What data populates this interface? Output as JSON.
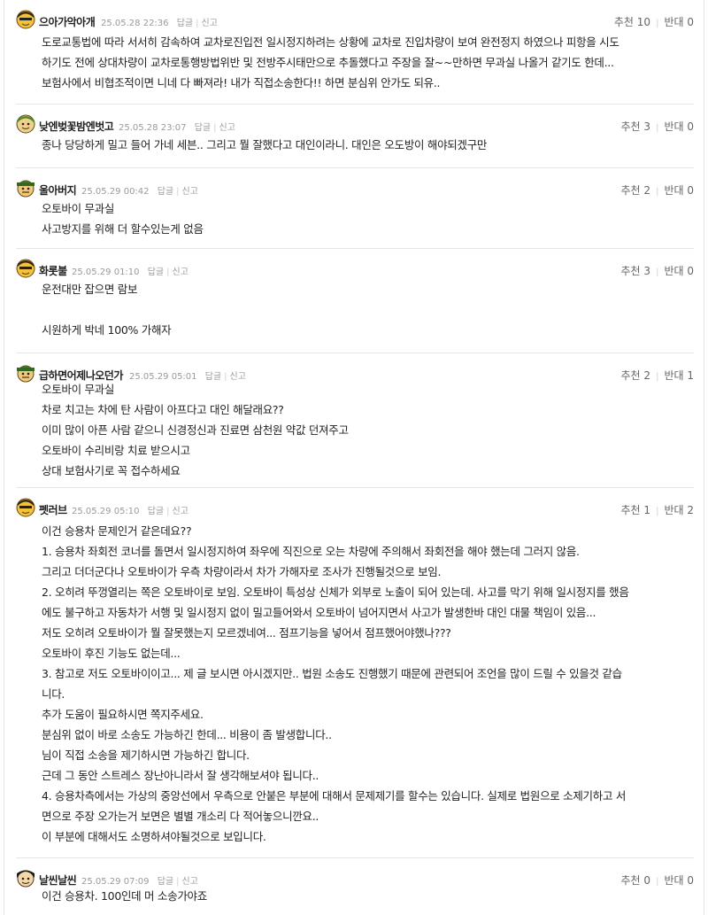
{
  "vote_labels": {
    "up": "추천",
    "down": "반대"
  },
  "actions": {
    "reply": "답글",
    "report": "신고"
  },
  "comments": [
    {
      "nickname": "으아가악아개",
      "date": "25.05.28 22:36",
      "up": "10",
      "down": "0",
      "avatar_icon": "yellow-avatar-icon",
      "lines": [
        "도로교통법에 따라 서서히 감속하여 교차로진입전 일시정지하려는 상황에 교차로 진입차량이 보여 완전정지 하였으나 피항을 시도",
        "하기도 전에 상대차량이 교차로통행방법위반 및 전방주시태만으로 추돌했다고 주장을 잘~~만하면 무과실 나올거 같기도 한데...",
        "보험사에서 비협조적이면 니네 다 빠져라! 내가 직접소송한다!! 하면 분심위 안가도 되유.."
      ]
    },
    {
      "nickname": "낮엔벚꽃밤엔벗고",
      "date": "25.05.28 23:07",
      "up": "3",
      "down": "0",
      "avatar_icon": "green-avatar-icon",
      "lines": [
        "종나 당당하게 밀고 들어 가네 세븐.. 그리고 뭘 잘했다고 대인이라니. 대인은 오도방이 해야되겠구만"
      ]
    },
    {
      "nickname": "울아버지",
      "date": "25.05.29 00:42",
      "up": "2",
      "down": "0",
      "avatar_icon": "soldier-avatar-icon",
      "lines": [
        "오토바이 무과실",
        "사고방지를 위해 더 할수있는게 없음"
      ]
    },
    {
      "nickname": "화롯불",
      "date": "25.05.29 01:10",
      "up": "3",
      "down": "0",
      "avatar_icon": "yellow-avatar-icon",
      "lines": [
        "운전대만 잡으면 람보",
        "",
        "시원하게 박네 100% 가해자"
      ]
    },
    {
      "nickname": "급하면어제나오던가",
      "date": "25.05.29 05:01",
      "up": "2",
      "down": "1",
      "avatar_icon": "soldier-avatar-icon",
      "lines": [
        "오토바이 무과실",
        "차로 치고는 차에 탄 사람이 아프다고 대인 해달래요??",
        "이미 많이 아픈 사람 같으니 신경정신과 진료면 삼천원 약값 던져주고",
        "오토바이 수리비랑 치료 받으시고",
        "상대 보험사기로 꼭 접수하세요"
      ]
    },
    {
      "nickname": "펫러브",
      "date": "25.05.29 05:10",
      "up": "1",
      "down": "2",
      "avatar_icon": "yellow-avatar-icon",
      "lines": [
        "이건 승용차 문제인거 같은데요??",
        "1. 승용차 좌회전 코너를 돌면서 일시정지하여 좌우에 직진으로 오는 차량에 주의해서 좌회전을 해야 했는데 그러지 않음.",
        "그리고 더더군다나 오토바이가 우측 차량이라서 차가 가해자로 조사가 진행될것으로 보임.",
        "2. 오히려 뚜껑열리는 쪽은 오토바이로 보임. 오토바이 특성상 신체가 외부로 노출이 되어 있는데. 사고를 막기 위해 일시정지를 했음",
        "에도 불구하고 자동차가 서행 및 일시정지 없이 밀고들어와서 오토바이 넘어지면서 사고가 발생한바 대인 대물 책임이 있음...",
        "저도 오히려 오토바이가 뭘 잘못했는지 모르겠네여... 점프기능을 넣어서 점프했어야했나???",
        "오토바이 후진 기능도 없는데...",
        "3. 참고로 저도 오토바이이고... 제 글 보시면 아시겠지만.. 법원 소송도 진행했기 때문에 관련되어 조언을 많이 드릴 수 있을것 같습",
        "니다.",
        "추가 도움이 필요하시면 쪽지주세요.",
        "분심위 없이 바로 소송도 가능하긴 한데... 비용이 좀 발생합니다..",
        "님이 직접 소송을 제기하시면 가능하긴 합니다.",
        "근데 그 동안 스트레스 장난아니라서 잘 생각해보셔야 됩니다..",
        "4. 승용차측에서는 가상의 중앙선에서 우측으로 안붙은 부분에 대해서 문제제기를 할수는 있습니다. 실제로 법원으로 소제기하고 서",
        "면으로 주장 오가는거 보면은 별별 개소리 다 적어놓으니깐요..",
        "이 부분에 대해서도 소명하셔야될것으로 보입니다."
      ]
    },
    {
      "nickname": "날씬날씬",
      "date": "25.05.29 07:09",
      "up": "0",
      "down": "0",
      "avatar_icon": "black-hair-avatar-icon",
      "lines": [
        "이건 승용차. 100인데 머 소송가야죠"
      ]
    }
  ]
}
